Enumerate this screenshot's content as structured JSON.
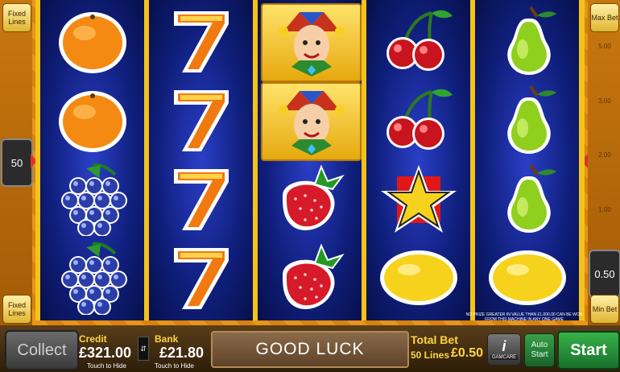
{
  "side": {
    "fixed_lines_label": "Fixed Lines",
    "max_bet_label": "Max Bet",
    "min_bet_label": "Min Bet",
    "lines_value": "50",
    "bet_value": "0.50",
    "scale": [
      "5.00",
      "3.00",
      "2.00",
      "1.00"
    ]
  },
  "reels": [
    {
      "symbols": [
        "orange",
        "orange",
        "grapes",
        "grapes"
      ]
    },
    {
      "symbols": [
        "seven",
        "seven",
        "seven",
        "seven"
      ]
    },
    {
      "symbols": [
        "joker",
        "joker",
        "strawberry",
        "strawberry"
      ]
    },
    {
      "symbols": [
        "cherries",
        "cherries",
        "star",
        "lemon"
      ]
    },
    {
      "symbols": [
        "pear",
        "pear",
        "pear",
        "lemon"
      ]
    }
  ],
  "notice": "NO PRIZE GREATER IN VALUE THAN £1,000.00 CAN BE WON FROM THIS MACHINE IN ANY ONE GAME",
  "bottom": {
    "collect_label": "Collect",
    "credit_label": "Credit",
    "credit_value": "£321.00",
    "credit_hint": "Touch to Hide",
    "bank_label": "Bank",
    "bank_value": "£21.80",
    "bank_hint": "Touch to Hide",
    "message": "GOOD LUCK",
    "total_bet_label": "Total Bet",
    "lines_text": "50 Lines",
    "total_bet_value": "£0.50",
    "info_label": "i",
    "gamcare_label": "GAMCARE",
    "auto_label": "Auto",
    "auto_start_label": "Start",
    "start_label": "Start"
  },
  "colors": {
    "reel_bg": "#0f1e7a",
    "frame": "#f3c21b",
    "start_green": "#37b24a",
    "label_yellow": "#ffd640"
  }
}
